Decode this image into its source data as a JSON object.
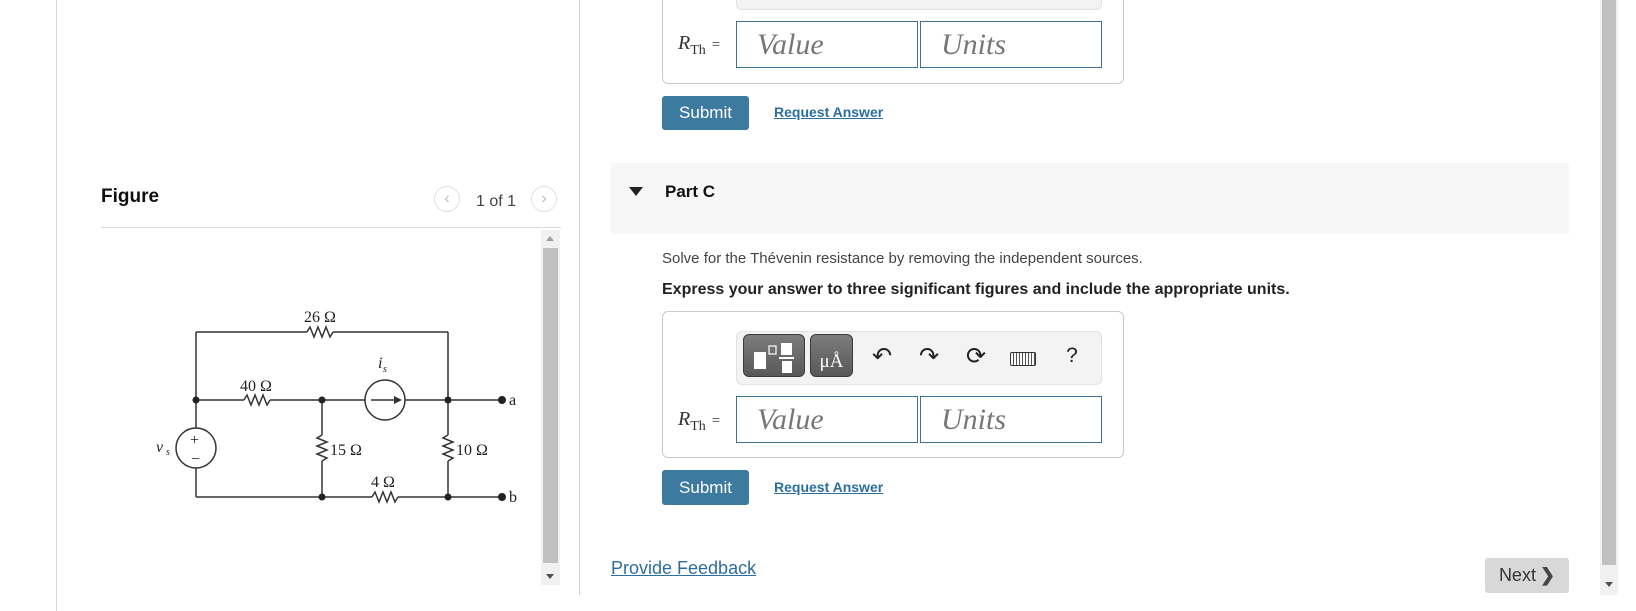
{
  "figure": {
    "title": "Figure",
    "counter": "1 of 1",
    "prev_icon": "chevron-left-icon",
    "next_icon": "chevron-right-icon",
    "circuit": {
      "resistors": [
        "26 Ω",
        "40 Ω",
        "15 Ω",
        "10 Ω",
        "4 Ω"
      ],
      "voltage_source_label": "v",
      "voltage_source_sub": "s",
      "voltage_source_plus": "+",
      "voltage_source_minus": "−",
      "current_source_label": "i",
      "current_source_sub": "s",
      "terminal_a": "a",
      "terminal_b": "b"
    }
  },
  "part_b": {
    "answer": {
      "label_main": "R",
      "label_sub": "Th",
      "label_eq": "=",
      "value_placeholder": "Value",
      "units_placeholder": "Units"
    },
    "submit_label": "Submit",
    "request_answer_label": "Request Answer"
  },
  "part_c": {
    "title": "Part C",
    "instruction": "Solve for the Thévenin resistance by removing the independent sources.",
    "instruction_bold": "Express your answer to three significant figures and include the appropriate units.",
    "toolbar": {
      "templates_icon": "fraction-template-icon",
      "units_label": "μÅ",
      "undo_icon": "undo-icon",
      "redo_icon": "redo-icon",
      "reset_icon": "reset-icon",
      "keyboard_icon": "keyboard-icon",
      "help_label": "?"
    },
    "answer": {
      "label_main": "R",
      "label_sub": "Th",
      "label_eq": "=",
      "value_placeholder": "Value",
      "units_placeholder": "Units"
    },
    "submit_label": "Submit",
    "request_answer_label": "Request Answer"
  },
  "footer": {
    "feedback_label": "Provide Feedback",
    "next_label": "Next"
  }
}
